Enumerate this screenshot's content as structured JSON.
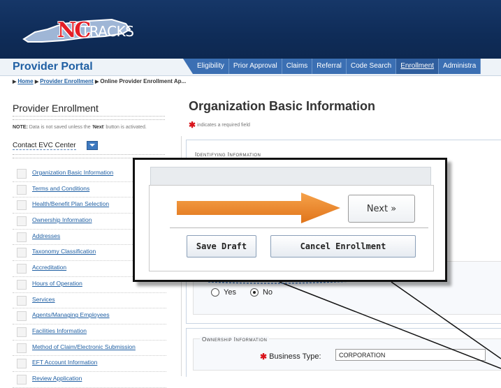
{
  "header": {
    "logo_text_nc": "NC",
    "logo_text_tracks": "TRACKS",
    "logo_name": "nctracks-logo"
  },
  "portal": {
    "title": "Provider Portal"
  },
  "nav": {
    "items": [
      {
        "label": "Eligibility",
        "active": false
      },
      {
        "label": "Prior Approval",
        "active": false
      },
      {
        "label": "Claims",
        "active": false
      },
      {
        "label": "Referral",
        "active": false
      },
      {
        "label": "Code Search",
        "active": false
      },
      {
        "label": "Enrollment",
        "active": true
      },
      {
        "label": "Administra",
        "active": false
      }
    ]
  },
  "breadcrumb": {
    "home": "Home",
    "provider_enrollment": "Provider Enrollment",
    "current": "Online Provider Enrollment Ap..."
  },
  "sidebar": {
    "title": "Provider Enrollment",
    "note_prefix": "NOTE:",
    "note_text_1": " Data is not saved unless the '",
    "note_bold": "Next",
    "note_text_2": "' button is activated.",
    "contact": "Contact EVC Center",
    "items": [
      {
        "label": "Organization Basic Information"
      },
      {
        "label": "Terms and Conditions"
      },
      {
        "label": "Health/Benefit Plan Selection"
      },
      {
        "label": "Ownership Information"
      },
      {
        "label": "Addresses"
      },
      {
        "label": "Taxonomy Classification"
      },
      {
        "label": "Accreditation"
      },
      {
        "label": "Hours of Operation"
      },
      {
        "label": "Services"
      },
      {
        "label": "Agents/Managing Employees"
      },
      {
        "label": "Facilities Information"
      },
      {
        "label": "Method of Claim/Electronic Submission"
      },
      {
        "label": "EFT Account Information"
      },
      {
        "label": "Review Application"
      }
    ]
  },
  "main": {
    "title": "Organization Basic Information",
    "required_star": "✱",
    "required_note": " indicates a required field",
    "identifying_legend": "Identifying Information",
    "radio_yes": "Yes",
    "radio_no": "No",
    "radio_selected": "No",
    "ownership_legend": "Ownership Information",
    "business_type_label": "Business Type:",
    "business_type_value": "CORPORATION"
  },
  "callout": {
    "next_label": "Next »",
    "save_draft_label": "Save Draft",
    "cancel_enrollment_label": "Cancel Enrollment",
    "arrow_color": "#f08a2a"
  },
  "colors": {
    "header_bg": "#163768",
    "nav_bg": "#3b6fb3",
    "link": "#1f5fa3",
    "required": "#d9141c"
  }
}
